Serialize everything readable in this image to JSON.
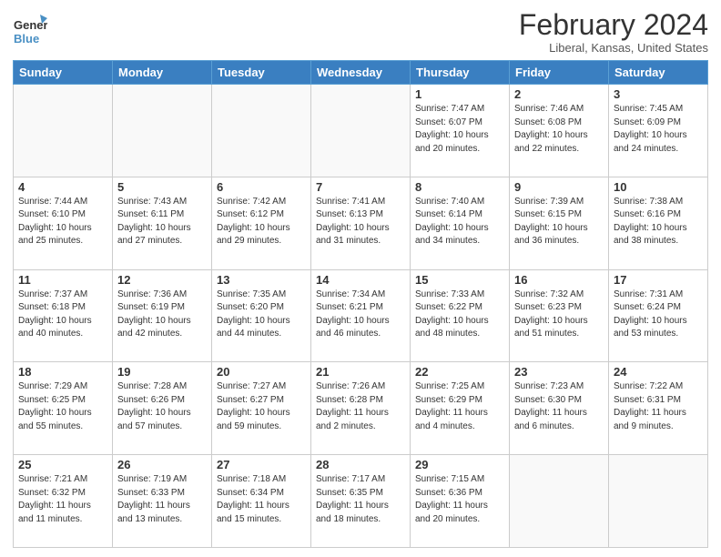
{
  "header": {
    "logo_line1": "General",
    "logo_line2": "Blue",
    "month_year": "February 2024",
    "location": "Liberal, Kansas, United States"
  },
  "days_of_week": [
    "Sunday",
    "Monday",
    "Tuesday",
    "Wednesday",
    "Thursday",
    "Friday",
    "Saturday"
  ],
  "weeks": [
    [
      {
        "day": "",
        "info": ""
      },
      {
        "day": "",
        "info": ""
      },
      {
        "day": "",
        "info": ""
      },
      {
        "day": "",
        "info": ""
      },
      {
        "day": "1",
        "info": "Sunrise: 7:47 AM\nSunset: 6:07 PM\nDaylight: 10 hours\nand 20 minutes."
      },
      {
        "day": "2",
        "info": "Sunrise: 7:46 AM\nSunset: 6:08 PM\nDaylight: 10 hours\nand 22 minutes."
      },
      {
        "day": "3",
        "info": "Sunrise: 7:45 AM\nSunset: 6:09 PM\nDaylight: 10 hours\nand 24 minutes."
      }
    ],
    [
      {
        "day": "4",
        "info": "Sunrise: 7:44 AM\nSunset: 6:10 PM\nDaylight: 10 hours\nand 25 minutes."
      },
      {
        "day": "5",
        "info": "Sunrise: 7:43 AM\nSunset: 6:11 PM\nDaylight: 10 hours\nand 27 minutes."
      },
      {
        "day": "6",
        "info": "Sunrise: 7:42 AM\nSunset: 6:12 PM\nDaylight: 10 hours\nand 29 minutes."
      },
      {
        "day": "7",
        "info": "Sunrise: 7:41 AM\nSunset: 6:13 PM\nDaylight: 10 hours\nand 31 minutes."
      },
      {
        "day": "8",
        "info": "Sunrise: 7:40 AM\nSunset: 6:14 PM\nDaylight: 10 hours\nand 34 minutes."
      },
      {
        "day": "9",
        "info": "Sunrise: 7:39 AM\nSunset: 6:15 PM\nDaylight: 10 hours\nand 36 minutes."
      },
      {
        "day": "10",
        "info": "Sunrise: 7:38 AM\nSunset: 6:16 PM\nDaylight: 10 hours\nand 38 minutes."
      }
    ],
    [
      {
        "day": "11",
        "info": "Sunrise: 7:37 AM\nSunset: 6:18 PM\nDaylight: 10 hours\nand 40 minutes."
      },
      {
        "day": "12",
        "info": "Sunrise: 7:36 AM\nSunset: 6:19 PM\nDaylight: 10 hours\nand 42 minutes."
      },
      {
        "day": "13",
        "info": "Sunrise: 7:35 AM\nSunset: 6:20 PM\nDaylight: 10 hours\nand 44 minutes."
      },
      {
        "day": "14",
        "info": "Sunrise: 7:34 AM\nSunset: 6:21 PM\nDaylight: 10 hours\nand 46 minutes."
      },
      {
        "day": "15",
        "info": "Sunrise: 7:33 AM\nSunset: 6:22 PM\nDaylight: 10 hours\nand 48 minutes."
      },
      {
        "day": "16",
        "info": "Sunrise: 7:32 AM\nSunset: 6:23 PM\nDaylight: 10 hours\nand 51 minutes."
      },
      {
        "day": "17",
        "info": "Sunrise: 7:31 AM\nSunset: 6:24 PM\nDaylight: 10 hours\nand 53 minutes."
      }
    ],
    [
      {
        "day": "18",
        "info": "Sunrise: 7:29 AM\nSunset: 6:25 PM\nDaylight: 10 hours\nand 55 minutes."
      },
      {
        "day": "19",
        "info": "Sunrise: 7:28 AM\nSunset: 6:26 PM\nDaylight: 10 hours\nand 57 minutes."
      },
      {
        "day": "20",
        "info": "Sunrise: 7:27 AM\nSunset: 6:27 PM\nDaylight: 10 hours\nand 59 minutes."
      },
      {
        "day": "21",
        "info": "Sunrise: 7:26 AM\nSunset: 6:28 PM\nDaylight: 11 hours\nand 2 minutes."
      },
      {
        "day": "22",
        "info": "Sunrise: 7:25 AM\nSunset: 6:29 PM\nDaylight: 11 hours\nand 4 minutes."
      },
      {
        "day": "23",
        "info": "Sunrise: 7:23 AM\nSunset: 6:30 PM\nDaylight: 11 hours\nand 6 minutes."
      },
      {
        "day": "24",
        "info": "Sunrise: 7:22 AM\nSunset: 6:31 PM\nDaylight: 11 hours\nand 9 minutes."
      }
    ],
    [
      {
        "day": "25",
        "info": "Sunrise: 7:21 AM\nSunset: 6:32 PM\nDaylight: 11 hours\nand 11 minutes."
      },
      {
        "day": "26",
        "info": "Sunrise: 7:19 AM\nSunset: 6:33 PM\nDaylight: 11 hours\nand 13 minutes."
      },
      {
        "day": "27",
        "info": "Sunrise: 7:18 AM\nSunset: 6:34 PM\nDaylight: 11 hours\nand 15 minutes."
      },
      {
        "day": "28",
        "info": "Sunrise: 7:17 AM\nSunset: 6:35 PM\nDaylight: 11 hours\nand 18 minutes."
      },
      {
        "day": "29",
        "info": "Sunrise: 7:15 AM\nSunset: 6:36 PM\nDaylight: 11 hours\nand 20 minutes."
      },
      {
        "day": "",
        "info": ""
      },
      {
        "day": "",
        "info": ""
      }
    ]
  ]
}
